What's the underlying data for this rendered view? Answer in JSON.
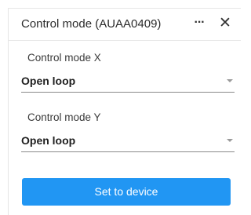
{
  "dialog": {
    "title": "Control mode (AUAA0409)",
    "more_label": "···",
    "close_label": "✕"
  },
  "fields": [
    {
      "label": "Control mode X",
      "value": "Open loop"
    },
    {
      "label": "Control mode Y",
      "value": "Open loop"
    }
  ],
  "actions": {
    "submit_label": "Set to device"
  },
  "colors": {
    "accent": "#2196f3"
  },
  "icons": {
    "more": "more-horizontal-icon",
    "close": "close-icon",
    "dropdown": "caret-down-icon"
  }
}
